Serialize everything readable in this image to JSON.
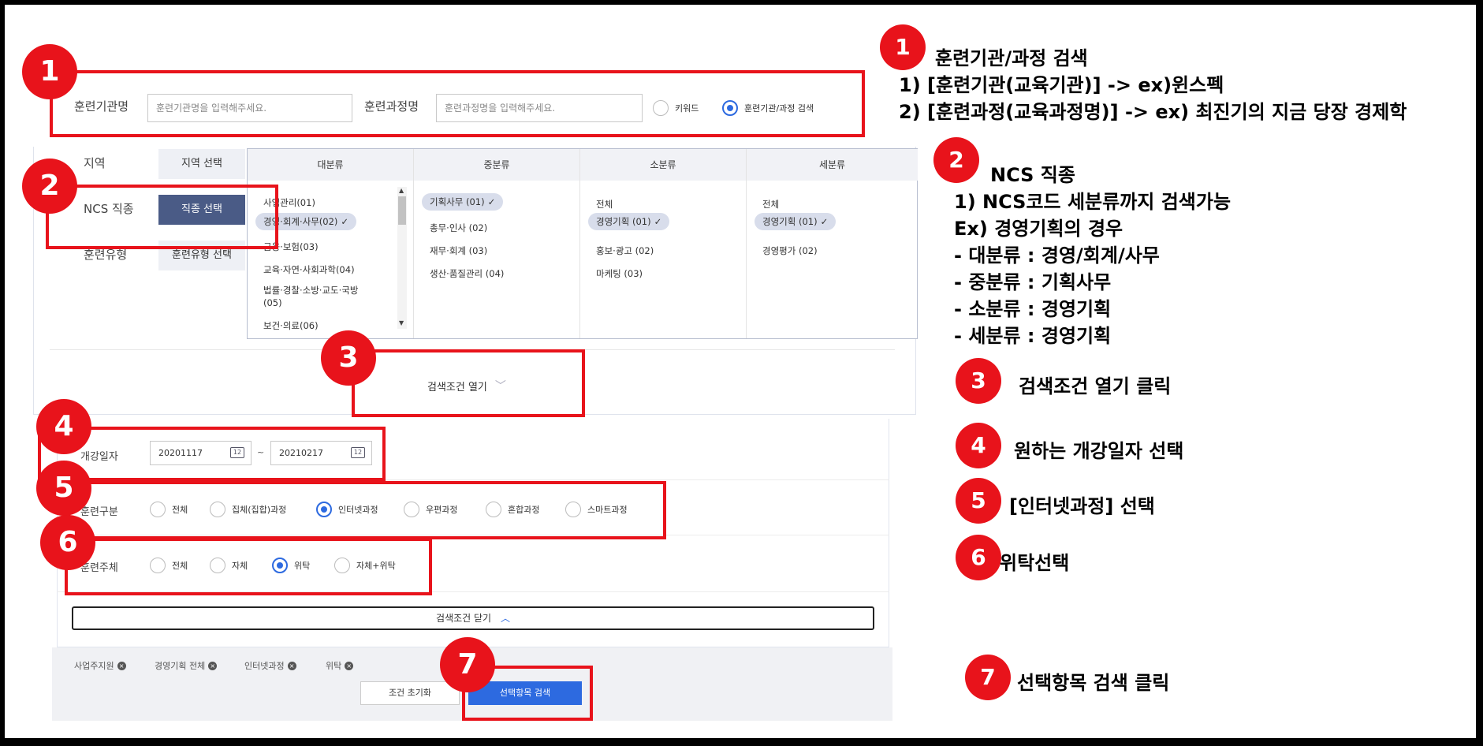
{
  "search": {
    "org_label": "훈련기관명",
    "org_placeholder": "훈련기관명을 입력해주세요.",
    "course_label": "훈련과정명",
    "course_placeholder": "훈련과정명을 입력해주세요.",
    "radio_keyword": "키워드",
    "radio_org_course": "훈련기관/과정 검색"
  },
  "side": {
    "region_label": "지역",
    "region_button": "지역 선택",
    "ncs_label": "NCS 직종",
    "ncs_button": "직종 선택",
    "type_label": "훈련유형",
    "type_button": "훈련유형 선택"
  },
  "ncs": {
    "headers": [
      "대분류",
      "중분류",
      "소분류",
      "세분류"
    ],
    "major": [
      "사업관리(01)",
      "경영·회계·사무(02)",
      "금융·보험(03)",
      "교육·자연·사회과학(04)",
      "법률·경찰·소방·교도·국방",
      "(05)",
      "보건·의료(06)"
    ],
    "middle": [
      "기획사무 (01)",
      "총무·인사 (02)",
      "재무·회계 (03)",
      "생산·품질관리 (04)"
    ],
    "minor": [
      "전체",
      "경영기획 (01)",
      "홍보·광고 (02)",
      "마케팅 (03)"
    ],
    "detail": [
      "전체",
      "경영기획 (01)",
      "경영평가 (02)"
    ]
  },
  "open_conditions": "검색조건 열기",
  "date": {
    "label": "개강일자",
    "start": "20201117",
    "sep": "~",
    "end": "20210217",
    "cal_icon_text": "12"
  },
  "train_kind": {
    "label": "훈련구분",
    "options": [
      "전체",
      "집체(집합)과정",
      "인터넷과정",
      "우편과정",
      "혼합과정",
      "스마트과정"
    ],
    "selected": "인터넷과정"
  },
  "train_subject": {
    "label": "훈련주체",
    "options": [
      "전체",
      "자체",
      "위탁",
      "자체+위탁"
    ],
    "selected": "위탁"
  },
  "close_conditions": "검색조건 닫기",
  "tags": [
    "사업주지원",
    "경영기획 전체",
    "인터넷과정",
    "위탁"
  ],
  "tag_remove_symbol": "×",
  "buttons": {
    "reset": "조건 초기화",
    "search": "선택항목 검색"
  },
  "badges": [
    "1",
    "2",
    "3",
    "4",
    "5",
    "6",
    "7"
  ],
  "annotations": {
    "a1_title": "훈련기관/과정 검색",
    "a1_line1": "1) [훈련기관(교육기관)] -> ex)윈스펙",
    "a1_line2": "2) [훈련과정(교육과정명)] -> ex) 최진기의 지금 당장 경제학",
    "a2_title": "NCS 직종",
    "a2_line1": "1)     NCS코드 세분류까지 검색가능",
    "a2_line2": "Ex) 경영기획의 경우",
    "a2_line3": "-     대분류 : 경영/회계/사무",
    "a2_line4": "-     중분류 : 기획사무",
    "a2_line5": "-     소분류 : 경영기획",
    "a2_line6": "-     세분류 : 경영기획",
    "a3": "검색조건 열기 클릭",
    "a4": "원하는 개강일자 선택",
    "a5": "[인터넷과정] 선택",
    "a6": "위탁선택",
    "a7": "선택항목 검색 클릭"
  },
  "colors": {
    "annotation_red": "#e8131b",
    "accent_blue": "#2d6ae0",
    "ncs_button": "#4a5b86"
  }
}
